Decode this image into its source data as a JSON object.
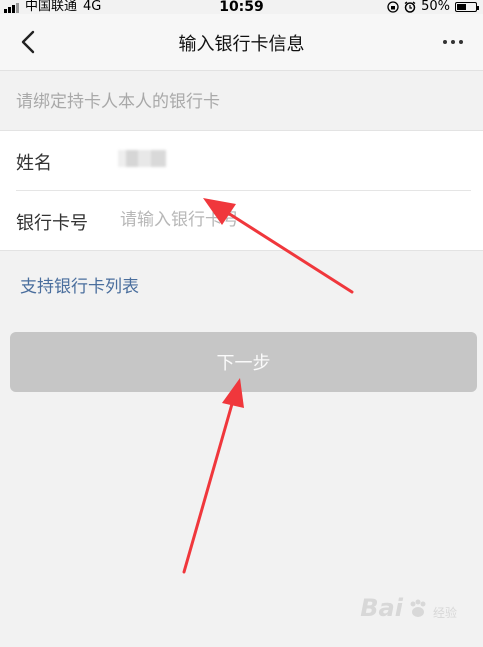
{
  "status_bar": {
    "carrier": "中国联通",
    "network": "4G",
    "time": "10:59",
    "battery_percent": "50%",
    "battery_level": 0.5
  },
  "nav": {
    "title": "输入银行卡信息"
  },
  "hint": "请绑定持卡人本人的银行卡",
  "form": {
    "name_label": "姓名",
    "card_label": "银行卡号",
    "card_placeholder": "请输入银行卡号",
    "card_value": ""
  },
  "supported_banks_link": "支持银行卡列表",
  "next_button": "下一步",
  "watermark": {
    "text": "Bai",
    "subtext": "经验"
  },
  "colors": {
    "link": "#4a6e9d",
    "button_disabled": "#c6c6c6",
    "annotation_arrow": "#f0373c"
  }
}
